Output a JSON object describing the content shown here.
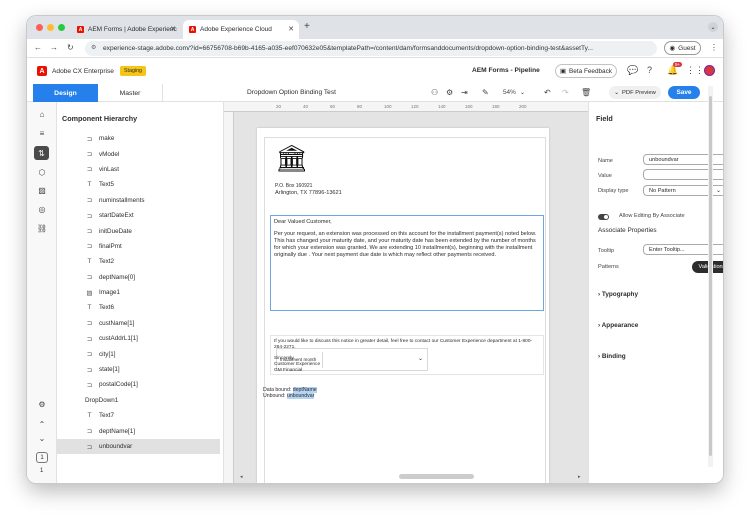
{
  "browser": {
    "tabs": [
      {
        "title": "AEM Forms | Adobe Experienc"
      },
      {
        "title": "Adobe Experience Cloud"
      }
    ],
    "url": "experience-stage.adobe.com/?id=66756708-b69b-4165-a035-eef070632e05&templatePath=/content/dam/formsanddocuments/dropdown-option-binding-test&assetTy...",
    "guest_label": "Guest"
  },
  "app": {
    "name": "Adobe CX Enterprise",
    "env_badge": "Staging",
    "pipeline": "AEM Forms - Pipeline",
    "beta_feedback": "Beta Feedback",
    "notification_count": "9+"
  },
  "toolbar": {
    "design_tab": "Design",
    "master_tab": "Master",
    "doc_title": "Dropdown Option Binding Test",
    "zoom": "54%",
    "pdf_preview": "PDF Preview",
    "save": "Save"
  },
  "hierarchy": {
    "title": "Component Hierarchy",
    "items": [
      {
        "label": "make",
        "icon": "field-icon"
      },
      {
        "label": "vModel",
        "icon": "field-icon"
      },
      {
        "label": "vinLast",
        "icon": "field-icon"
      },
      {
        "label": "Text5",
        "icon": "text-icon"
      },
      {
        "label": "numinstallments",
        "icon": "field-icon"
      },
      {
        "label": "startDateExt",
        "icon": "field-icon"
      },
      {
        "label": "initDueDate",
        "icon": "field-icon"
      },
      {
        "label": "finalPmt",
        "icon": "field-icon"
      },
      {
        "label": "Text2",
        "icon": "text-icon"
      },
      {
        "label": "deptName[0]",
        "icon": "field-icon"
      },
      {
        "label": "Image1",
        "icon": "image-icon"
      },
      {
        "label": "Text6",
        "icon": "text-icon"
      },
      {
        "label": "custName[1]",
        "icon": "field-icon"
      },
      {
        "label": "custAddrL1[1]",
        "icon": "field-icon"
      },
      {
        "label": "city[1]",
        "icon": "field-icon"
      },
      {
        "label": "state[1]",
        "icon": "field-icon"
      },
      {
        "label": "postalCode[1]",
        "icon": "field-icon"
      },
      {
        "label": "DropDown1",
        "icon": ""
      },
      {
        "label": "Text7",
        "icon": "text-icon"
      },
      {
        "label": "deptName[1]",
        "icon": "field-icon"
      },
      {
        "label": "unboundvar",
        "icon": "field-icon",
        "selected": true
      }
    ]
  },
  "rail": {
    "page_number": "1",
    "page_count": "1"
  },
  "ruler": {
    "marks": [
      "20",
      "40",
      "60",
      "80",
      "100",
      "120",
      "140",
      "160",
      "180",
      "200"
    ]
  },
  "document": {
    "po_box": "P.O. Box 160921",
    "city_line": "Arlington, TX 77896-13621",
    "salutation": "Dear Valued Customer,",
    "body": "Per your request, an extension was processed on this account for the installment payment(s) noted below. This has changed your maturity date, and your maturity date has been extended by the number of months for which your extension was granted. We are extending 10 installment(s), beginning with the installment originally due . Your next payment due date is  which may reflect other payments received.",
    "installment_label": "Installment month",
    "contact": "If you would like to discuss this notice in greater detail, feel free to contact our Customer Experience department at 1-800-284-2271.",
    "closing": "Sincerely,",
    "sign1": "Customer Experience",
    "sign2": "GM Financial",
    "data_bound_label": "Data bound:",
    "data_bound_value": "deptName",
    "unbound_label": "Unbound:",
    "unbound_value": "unboundvar"
  },
  "field": {
    "title": "Field",
    "name_label": "Name",
    "name_value": "unboundvar",
    "value_label": "Value",
    "value_value": "",
    "display_type_label": "Display type",
    "display_type_value": "No Pattern",
    "allow_editing": "Allow Editing By Associate",
    "associate_props": "Associate Properties",
    "tooltip_label": "Tooltip",
    "tooltip_placeholder": "Enter Tooltip...",
    "patterns_label": "Patterns",
    "validations": "Validations",
    "sections": [
      "Typography",
      "Appearance",
      "Binding"
    ]
  }
}
